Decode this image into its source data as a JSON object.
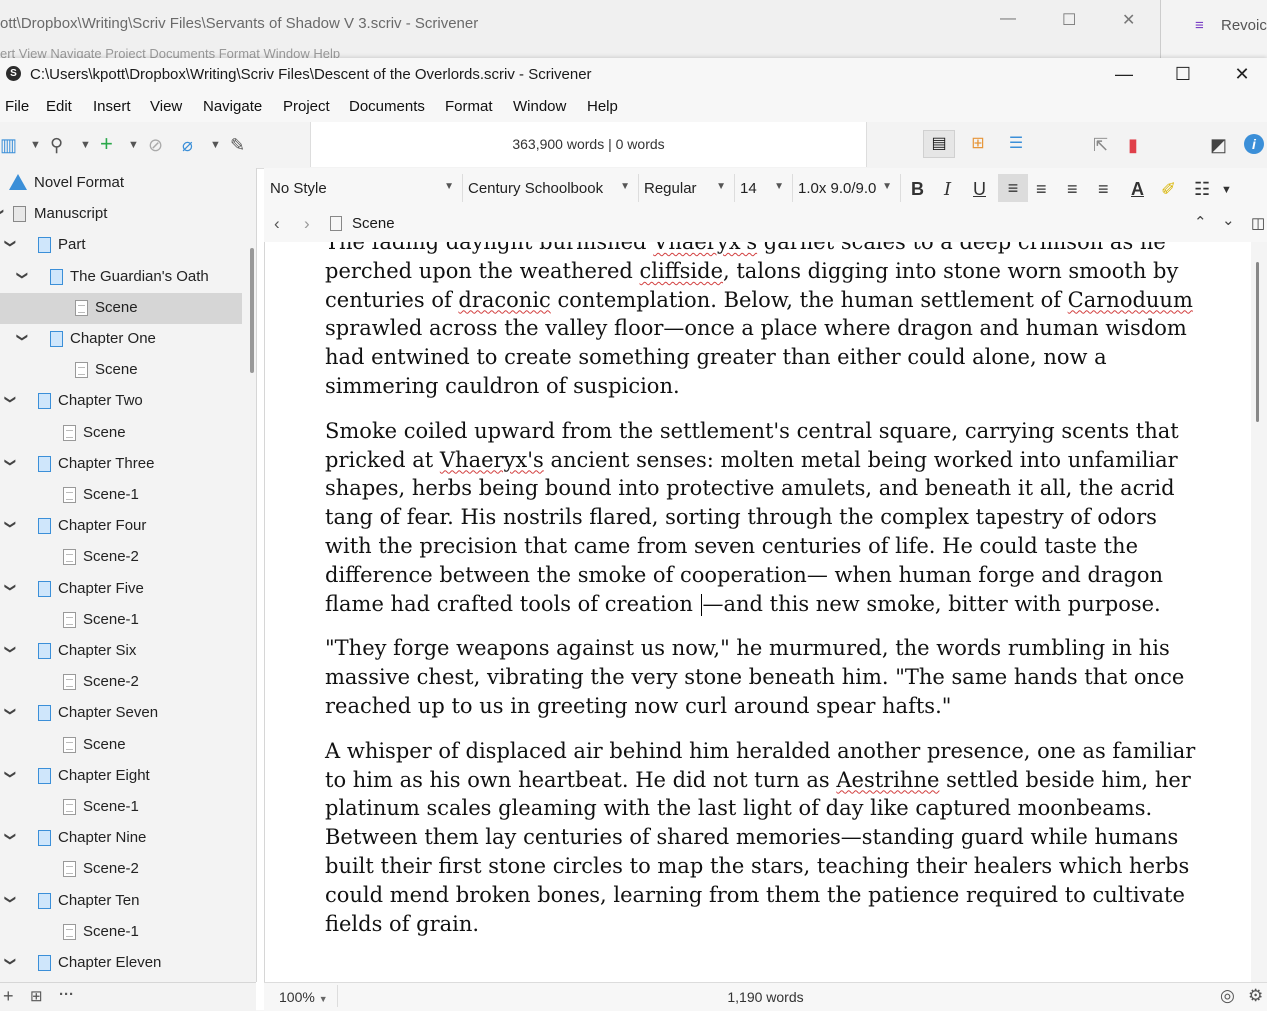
{
  "background_window": {
    "title": "ott\\Dropbox\\Writing\\Scriv Files\\Servants of Shadow V 3.scriv - Scrivener",
    "menu": "ert     View     Navigate     Project     Documents     Format     Window     Help",
    "side_app_label": "Revoic"
  },
  "window": {
    "title": "C:\\Users\\kpott\\Dropbox\\Writing\\Scriv Files\\Descent of the Overlords.scriv - Scrivener",
    "app_icon": "S"
  },
  "menu": [
    "File",
    "Edit",
    "Insert",
    "View",
    "Navigate",
    "Project",
    "Documents",
    "Format",
    "Window",
    "Help"
  ],
  "toolbar": {
    "word_count": "363,900 words | 0 words"
  },
  "binder": {
    "items": [
      {
        "label": "Novel Format",
        "type": "warning",
        "level": 0,
        "expand": ""
      },
      {
        "label": "Manuscript",
        "type": "book",
        "level": 0,
        "expand": "v"
      },
      {
        "label": "Part",
        "type": "folder",
        "level": 1,
        "expand": "v"
      },
      {
        "label": "The Guardian's Oath",
        "type": "folder",
        "level": 2,
        "expand": "v"
      },
      {
        "label": "Scene",
        "type": "doc",
        "level": 3,
        "expand": "",
        "selected": true
      },
      {
        "label": "Chapter One",
        "type": "folder",
        "level": 2,
        "expand": "v"
      },
      {
        "label": "Scene",
        "type": "doc",
        "level": 3,
        "expand": ""
      },
      {
        "label": "Chapter Two",
        "type": "folder",
        "level": 1,
        "expand": "v"
      },
      {
        "label": "Scene",
        "type": "doc",
        "level": 2,
        "expand": ""
      },
      {
        "label": "Chapter Three",
        "type": "folder",
        "level": 1,
        "expand": "v"
      },
      {
        "label": "Scene-1",
        "type": "doc",
        "level": 2,
        "expand": ""
      },
      {
        "label": "Chapter Four",
        "type": "folder",
        "level": 1,
        "expand": "v"
      },
      {
        "label": "Scene-2",
        "type": "doc",
        "level": 2,
        "expand": ""
      },
      {
        "label": "Chapter Five",
        "type": "folder",
        "level": 1,
        "expand": "v"
      },
      {
        "label": "Scene-1",
        "type": "doc",
        "level": 2,
        "expand": ""
      },
      {
        "label": "Chapter Six",
        "type": "folder",
        "level": 1,
        "expand": "v"
      },
      {
        "label": "Scene-2",
        "type": "doc",
        "level": 2,
        "expand": ""
      },
      {
        "label": "Chapter Seven",
        "type": "folder",
        "level": 1,
        "expand": "v"
      },
      {
        "label": "Scene",
        "type": "doc",
        "level": 2,
        "expand": ""
      },
      {
        "label": "Chapter Eight",
        "type": "folder",
        "level": 1,
        "expand": "v"
      },
      {
        "label": "Scene-1",
        "type": "doc",
        "level": 2,
        "expand": ""
      },
      {
        "label": "Chapter Nine",
        "type": "folder",
        "level": 1,
        "expand": "v"
      },
      {
        "label": "Scene-2",
        "type": "doc",
        "level": 2,
        "expand": ""
      },
      {
        "label": "Chapter Ten",
        "type": "folder",
        "level": 1,
        "expand": "v"
      },
      {
        "label": "Scene-1",
        "type": "doc",
        "level": 2,
        "expand": ""
      },
      {
        "label": "Chapter Eleven",
        "type": "folder",
        "level": 1,
        "expand": "v"
      }
    ],
    "footer_more": "···"
  },
  "format": {
    "style": "No Style",
    "font": "Century Schoolbook",
    "weight": "Regular",
    "size": "14",
    "spacing": "1.0x 9.0/9.0",
    "bold": "B",
    "italic": "I",
    "underline": "U",
    "text_color_glyph": "A"
  },
  "header": {
    "doc_title": "Scene"
  },
  "editor": {
    "paragraphs": [
      [
        {
          "t": "The fading daylight burnished "
        },
        {
          "t": "Vhaeryx's",
          "s": true
        },
        {
          "t": " garnet scales to a deep crimson as he perched upon the weathered "
        },
        {
          "t": "cliffside",
          "s": true
        },
        {
          "t": ", talons digging into stone worn smooth by centuries of "
        },
        {
          "t": "draconic",
          "s": true
        },
        {
          "t": " contemplation. Below, the human settlement of "
        },
        {
          "t": "Carnoduum",
          "s": true
        },
        {
          "t": " sprawled across the valley floor—once a place where dragon and human wisdom had entwined to create something greater than either could alone, now a simmering cauldron of suspicion."
        }
      ],
      [
        {
          "t": "Smoke coiled upward from the settlement's central square, carrying scents that pricked at "
        },
        {
          "t": "Vhaeryx's",
          "s": true
        },
        {
          "t": " ancient senses: molten metal being worked into unfamiliar shapes, herbs being bound into protective amulets, and beneath it all, the acrid tang of fear. His nostrils flared, sorting through the complex tapestry of odors with the precision that came from seven centuries of life. He could taste the difference between the smoke of cooperation— when human forge and dragon flame had crafted tools of creation "
        },
        {
          "caret": true
        },
        {
          "t": "—and this new smoke, bitter with purpose."
        }
      ],
      [
        {
          "t": "\"They forge weapons against us now,\" he murmured, the words rumbling in his massive chest, vibrating the very stone beneath him. \"The same hands that once reached up to us in greeting now curl around spear hafts.\""
        }
      ],
      [
        {
          "t": "A whisper of displaced air behind him heralded another presence, one as familiar to him as his own heartbeat. He did not turn as "
        },
        {
          "t": "Aestrihne",
          "s": true
        },
        {
          "t": " settled beside him, her platinum scales gleaming with the last light of day like captured moonbeams. Between them lay centuries of shared memories—standing guard while humans built their first stone circles to map the stars, teaching their healers which herbs could mend broken bones, learning from them the patience required to cultivate fields of grain."
        }
      ]
    ]
  },
  "footer": {
    "zoom": "100%",
    "word_count": "1,190 words"
  },
  "colors": {
    "accent_blue": "#3b8fd8",
    "bookmark_red": "#e0404a",
    "spell_red": "#d24040"
  }
}
